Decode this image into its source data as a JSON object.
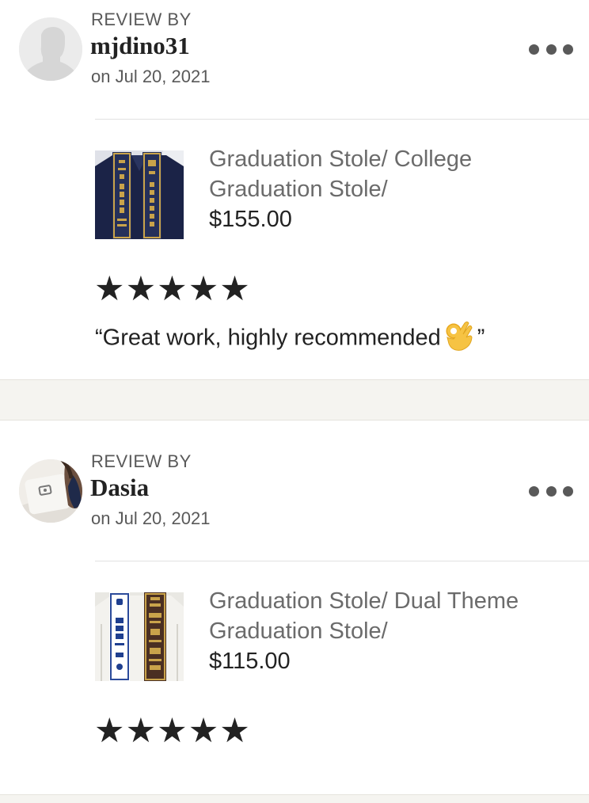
{
  "reviews": [
    {
      "review_by_label": "REVIEW BY",
      "reviewer": "mjdino31",
      "date": "on Jul 20, 2021",
      "avatar_icon": "default-user-silhouette",
      "product": {
        "title": "Graduation Stole/ College Graduation Stole/",
        "price": "$155.00",
        "thumbnail": "navy-gown-with-gold-stole"
      },
      "rating": 5,
      "stars": [
        "★",
        "★",
        "★",
        "★",
        "★"
      ],
      "text_open": "“Great work, highly recommended",
      "text_emoji": "ok-hand-emoji",
      "text_close": "”"
    },
    {
      "review_by_label": "REVIEW BY",
      "reviewer": "Dasia",
      "date": "on Jul 20, 2021",
      "avatar_icon": "user-photo",
      "product": {
        "title": "Graduation Stole/ Dual Theme Graduation Stole/",
        "price": "$115.00",
        "thumbnail": "white-gown-with-dual-stole"
      },
      "rating": 5,
      "stars": [
        "★",
        "★",
        "★",
        "★",
        "★"
      ]
    }
  ],
  "colors": {
    "text_primary": "#222222",
    "text_secondary": "#595959",
    "separator_bg": "#f5f4f0",
    "emoji_yellow": "#f6c343"
  }
}
